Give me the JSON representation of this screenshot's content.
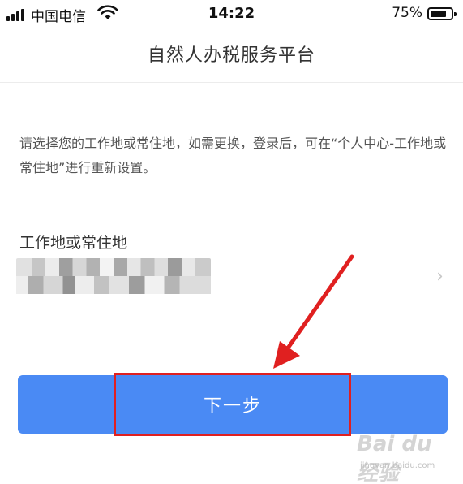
{
  "status_bar": {
    "carrier": "中国电信",
    "time": "14:22",
    "battery": "75%"
  },
  "header": {
    "title": "自然人办税服务平台"
  },
  "notice": {
    "text": "请选择您的工作地或常住地，如需更换，登录后，可在“个人中心-工作地或常住地”进行重新设置。"
  },
  "field": {
    "label": "工作地或常住地",
    "chevron": "›"
  },
  "next_button": {
    "label": "下一步"
  },
  "annotation": {
    "color": "#e02020"
  },
  "watermark": {
    "brand": "Bai du 经验",
    "url": "jingyan.baidu.com"
  },
  "colors": {
    "primary": "#4a8af4",
    "highlight": "#e02020"
  }
}
